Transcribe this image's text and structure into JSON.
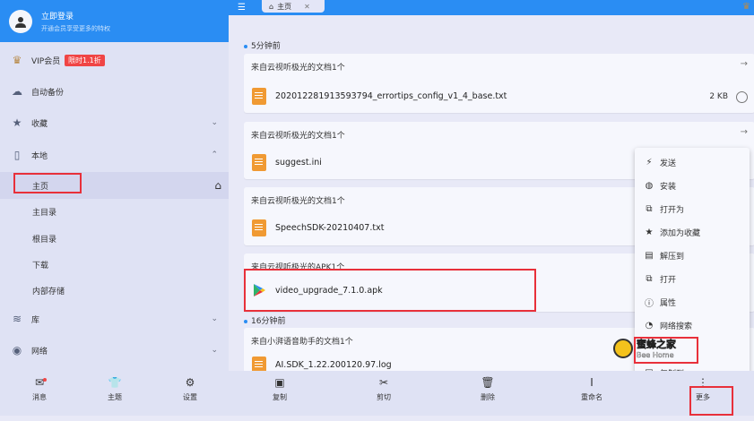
{
  "profile": {
    "title": "立即登录",
    "subtitle": "开通会员享受更多的特权"
  },
  "topbar": {
    "tab_label": "主页",
    "close": "✕"
  },
  "sidebar": {
    "vip_label": "VIP会员",
    "vip_badge": "限时1.1折",
    "items": [
      {
        "label": "自动备份",
        "icon": "cloud-icon"
      },
      {
        "label": "收藏",
        "icon": "star-icon"
      },
      {
        "label": "本地",
        "icon": "phone-icon"
      },
      {
        "label": "库",
        "icon": "layers-icon"
      },
      {
        "label": "网络",
        "icon": "globe-icon"
      }
    ],
    "local_sub": [
      {
        "label": "主页"
      },
      {
        "label": "主目录"
      },
      {
        "label": "根目录"
      },
      {
        "label": "下载"
      },
      {
        "label": "内部存储"
      }
    ]
  },
  "content": {
    "section1": "5分钟前",
    "section2": "16分钟前",
    "cards": [
      {
        "header": "来自云视听极光的文档1个",
        "file": "20201228191359​3794_errortips_config_v1_4_base.txt",
        "size": "2 KB"
      },
      {
        "header": "来自云视听极光的文档1个",
        "file": "suggest.ini"
      },
      {
        "header": "来自云视听极光的文档1个",
        "file": "SpeechSDK-20210407.txt"
      },
      {
        "header": "来自云视听极光的APK1个",
        "file": "video_upgrade_7.1.0.apk"
      },
      {
        "header": "来自小湃语音助手的文档1个",
        "file": "AI.SDK_1.22.200120.97.log"
      }
    ]
  },
  "context_menu": {
    "items": [
      {
        "label": "发送",
        "icon": "send-icon"
      },
      {
        "label": "安装",
        "icon": "android-icon"
      },
      {
        "label": "打开为",
        "icon": "open-with-icon"
      },
      {
        "label": "添加为收藏",
        "icon": "star-icon"
      },
      {
        "label": "解压到",
        "icon": "extract-icon"
      },
      {
        "label": "打开",
        "icon": "open-icon"
      },
      {
        "label": "属性",
        "icon": "info-icon"
      },
      {
        "label": "网络搜索",
        "icon": "web-search-icon"
      },
      {
        "label": "复制到",
        "icon": "copy-to-icon"
      }
    ]
  },
  "watermark": {
    "cn": "蜜蜂之家",
    "en": "Bee Home"
  },
  "bottom_left": [
    {
      "label": "消息"
    },
    {
      "label": "主题"
    },
    {
      "label": "设置"
    }
  ],
  "bottom_right": [
    {
      "label": "复制"
    },
    {
      "label": "剪切"
    },
    {
      "label": "删除"
    },
    {
      "label": "重命名"
    },
    {
      "label": "更多"
    }
  ],
  "colors": {
    "accent": "#2a8df3",
    "highlight_border": "#e8303a",
    "file_icon": "#f09a33"
  }
}
